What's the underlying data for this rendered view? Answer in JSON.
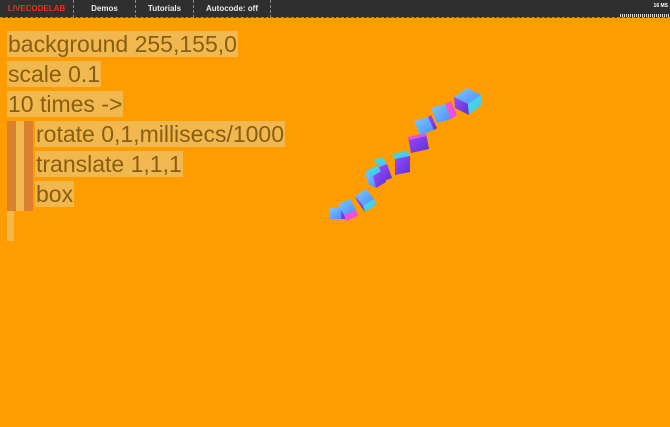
{
  "menu": {
    "brand": "LIVECODELAB",
    "demos": "Demos",
    "tutorials": "Tutorials",
    "autocode": "Autocode: off"
  },
  "stats": {
    "label": "16 MS"
  },
  "editor": {
    "lines": [
      "background 255,155,0",
      "scale 0.1",
      "10 times ->",
      "rotate 0,1,millisecs/1000",
      "translate 1,1,1",
      "box"
    ]
  },
  "colors": {
    "background": "#ff9c00",
    "menubar": "#2f2f2f",
    "brand": "#e8331e",
    "code_highlight": "#f0b84e",
    "code_text": "#8a5e10",
    "indent_marker": "#d9812e"
  },
  "icons": {
    "stats_graph": "stats-graph-icon"
  }
}
